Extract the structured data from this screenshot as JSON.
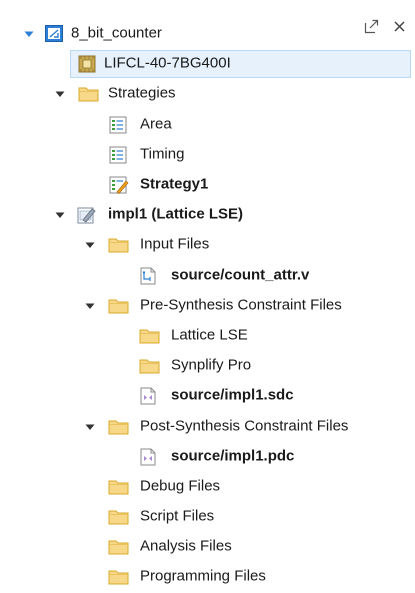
{
  "panel": {
    "controls": {
      "restore_icon": "restore-window-icon",
      "close_icon": "close-icon"
    }
  },
  "tree": {
    "project": {
      "label": "8_bit_counter",
      "icon": "project-icon"
    },
    "device": {
      "label": "LIFCL-40-7BG400I",
      "icon": "chip-icon"
    },
    "strategies": {
      "label": "Strategies",
      "items": [
        {
          "label": "Area"
        },
        {
          "label": "Timing"
        },
        {
          "label": "Strategy1"
        }
      ]
    },
    "impl": {
      "label": "impl1 (Lattice LSE)",
      "icon": "implementation-icon"
    },
    "input_files": {
      "label": "Input Files",
      "files": [
        {
          "label": "source/count_attr.v"
        }
      ]
    },
    "pre_synth": {
      "label": "Pre-Synthesis Constraint Files",
      "folders": [
        {
          "label": "Lattice LSE"
        },
        {
          "label": "Synplify Pro"
        }
      ],
      "files": [
        {
          "label": "source/impl1.sdc"
        }
      ]
    },
    "post_synth": {
      "label": "Post-Synthesis Constraint Files",
      "files": [
        {
          "label": "source/impl1.pdc"
        }
      ]
    },
    "other_folders": [
      {
        "label": "Debug Files"
      },
      {
        "label": "Script Files"
      },
      {
        "label": "Analysis Files"
      },
      {
        "label": "Programming Files"
      }
    ]
  },
  "colors": {
    "accent_blue": "#2b7fd4",
    "folder_fill": "#f7d889",
    "folder_stroke": "#d9a92b",
    "selection_bg": "#e6f1fb",
    "selection_border": "#b9d8f4"
  }
}
